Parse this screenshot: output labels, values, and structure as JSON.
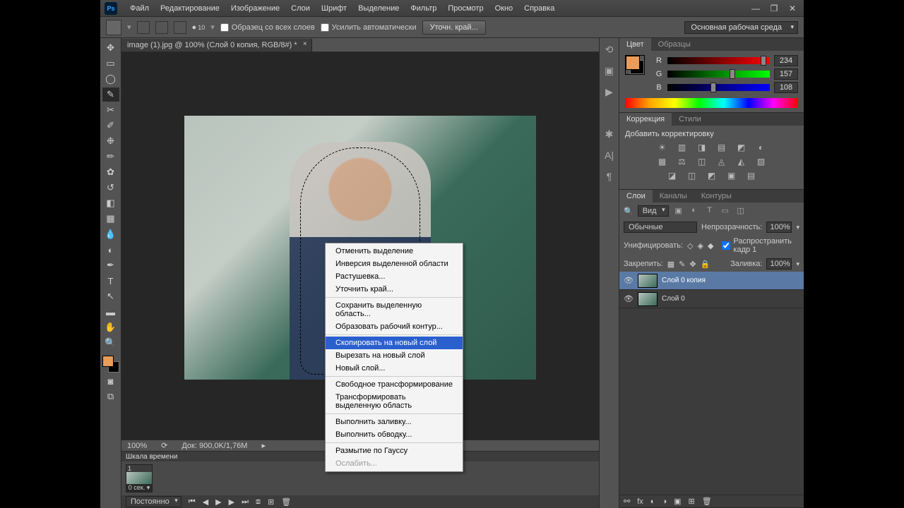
{
  "title_ps": "Ps",
  "menubar": [
    "Файл",
    "Редактирование",
    "Изображение",
    "Слои",
    "Шрифт",
    "Выделение",
    "Фильтр",
    "Просмотр",
    "Окно",
    "Справка"
  ],
  "optbar": {
    "size": "10",
    "chk1": "Образец со всех слоев",
    "chk2": "Усилить автоматически",
    "refine": "Уточн. край...",
    "workspace": "Основная рабочая среда"
  },
  "doctab": "image (1).jpg @ 100% (Слой 0 копия, RGB/8#) *",
  "color_panel": {
    "tab1": "Цвет",
    "tab2": "Образцы",
    "r": {
      "label": "R",
      "val": "234",
      "pos": 91
    },
    "g": {
      "label": "G",
      "val": "157",
      "pos": 61
    },
    "b": {
      "label": "B",
      "val": "108",
      "pos": 42
    }
  },
  "adjust_panel": {
    "tab1": "Коррекция",
    "tab2": "Стили",
    "title": "Добавить корректировку"
  },
  "layers_panel": {
    "tab1": "Слои",
    "tab2": "Каналы",
    "tab3": "Контуры",
    "filter": "Вид",
    "blend": "Обычные",
    "opacity_lbl": "Непрозрачность:",
    "opacity": "100%",
    "unify": "Унифицировать:",
    "propagate": "Распространить кадр 1",
    "lock": "Закрепить:",
    "fill_lbl": "Заливка:",
    "fill": "100%",
    "layers": [
      {
        "name": "Слой 0 копия",
        "selected": true
      },
      {
        "name": "Слой 0",
        "selected": false
      }
    ]
  },
  "status": {
    "zoom": "100%",
    "doc": "Док: 900,0K/1,76M"
  },
  "timeline": {
    "title": "Шкала времени",
    "frame_no": "1",
    "dur": "0 сек. ▾",
    "loop": "Постоянно"
  },
  "ctx": {
    "items": [
      {
        "t": "Отменить выделение"
      },
      {
        "t": "Инверсия выделенной области"
      },
      {
        "t": "Растушевка..."
      },
      {
        "t": "Уточнить край..."
      },
      {
        "sep": true
      },
      {
        "t": "Сохранить выделенную область..."
      },
      {
        "t": "Образовать рабочий контур..."
      },
      {
        "sep": true
      },
      {
        "t": "Скопировать на новый слой",
        "hov": true
      },
      {
        "t": "Вырезать на новый слой"
      },
      {
        "t": "Новый слой..."
      },
      {
        "sep": true
      },
      {
        "t": "Свободное трансформирование"
      },
      {
        "t": "Трансформировать выделенную область"
      },
      {
        "sep": true
      },
      {
        "t": "Выполнить заливку..."
      },
      {
        "t": "Выполнить обводку..."
      },
      {
        "sep": true
      },
      {
        "t": "Размытие по Гауссу"
      },
      {
        "t": "Ослабить...",
        "dis": true
      }
    ]
  }
}
